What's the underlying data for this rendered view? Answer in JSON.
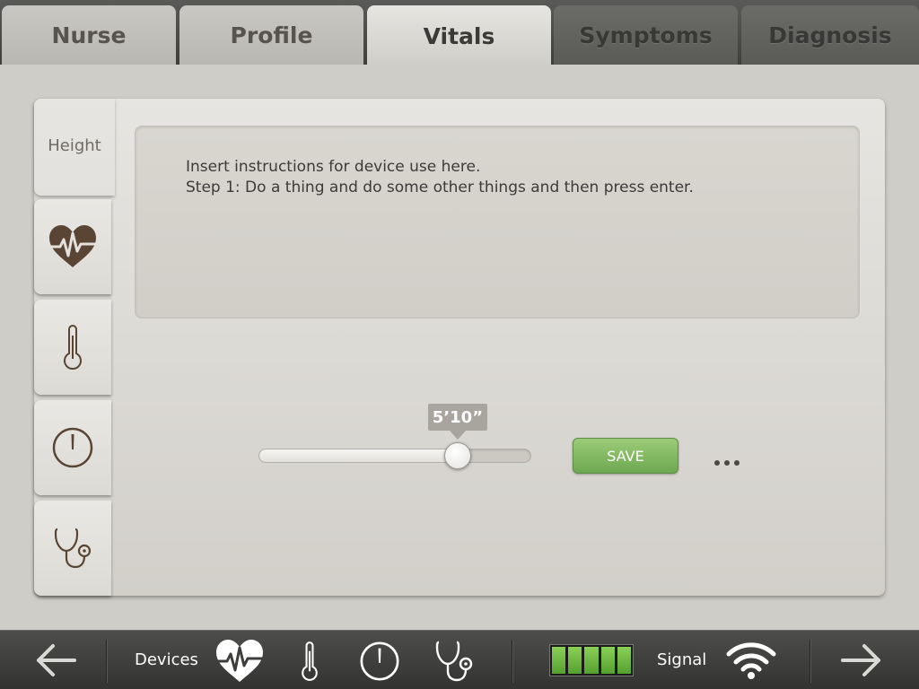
{
  "top_tabs": [
    {
      "label": "Nurse",
      "state": "enabled"
    },
    {
      "label": "Profile",
      "state": "enabled"
    },
    {
      "label": "Vitals",
      "state": "active"
    },
    {
      "label": "Symptoms",
      "state": "disabled"
    },
    {
      "label": "Diagnosis",
      "state": "disabled"
    }
  ],
  "side_tabs": {
    "height_label": "Height",
    "icons": [
      "heart-rate-icon",
      "thermometer-icon",
      "gauge-icon",
      "stethoscope-icon"
    ]
  },
  "instructions": {
    "line1": "Insert instructions for device use here.",
    "line2": "Step 1: Do a thing and do some other things and then press enter."
  },
  "slider": {
    "value_label": "5’10”",
    "fraction": 0.73
  },
  "save_label": "SAVE",
  "bottom_bar": {
    "devices_label": "Devices",
    "signal_label": "Signal",
    "battery_cells": 5,
    "battery_color": "#6ab93c",
    "device_icons": [
      "heart-rate-icon",
      "thermometer-icon",
      "gauge-icon",
      "stethoscope-icon"
    ]
  },
  "colors": {
    "save_green": "#7cb95c",
    "topbar_dark": "#4a4a48",
    "card_bg": "#e3e1dd"
  }
}
